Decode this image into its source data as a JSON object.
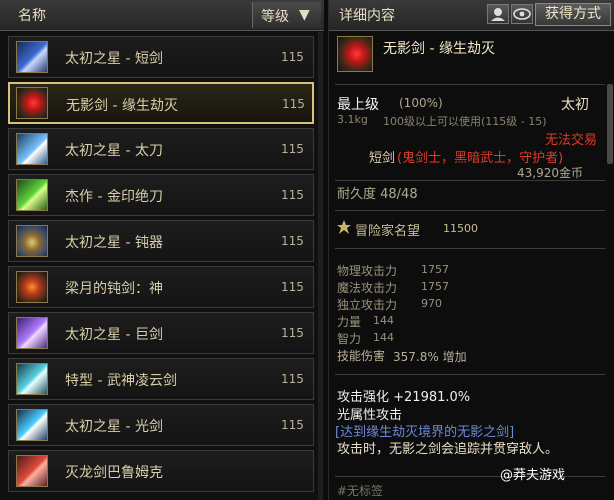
{
  "list": {
    "header_name": "名称",
    "header_level": "等级",
    "header_sort_arrow": "▼",
    "items": [
      {
        "name": "太初之星 - 短剑",
        "level": "115",
        "icon": "short-sword-icon"
      },
      {
        "name": "无影剑 - 缘生劫灭",
        "level": "115",
        "icon": "wuying-sword-icon"
      },
      {
        "name": "太初之星 - 太刀",
        "level": "115",
        "icon": "katana-icon"
      },
      {
        "name": "杰作 - 金印绝刀",
        "level": "115",
        "icon": "gold-blade-icon"
      },
      {
        "name": "太初之星 - 钝器",
        "level": "115",
        "icon": "blunt-weapon-icon"
      },
      {
        "name": "梁月的钝剑：神",
        "level": "115",
        "icon": "blunt-sword-icon"
      },
      {
        "name": "太初之星 - 巨剑",
        "level": "115",
        "icon": "greatsword-icon"
      },
      {
        "name": "特型 - 武神凌云剑",
        "level": "115",
        "icon": "lingyun-sword-icon"
      },
      {
        "name": "太初之星 - 光剑",
        "level": "115",
        "icon": "lightsaber-icon"
      },
      {
        "name": "灭龙剑巴鲁姆克",
        "level": "",
        "icon": "dragon-sword-icon"
      }
    ]
  },
  "detail": {
    "header_title": "详细内容",
    "acquire_button": "获得方式",
    "item_name": "无影剑 - 缘生劫灭",
    "grade": "最上级",
    "grade_pct": "(100%)",
    "rarity": "太初",
    "weight": "3.1kg",
    "usage": "100级以上可以使用(115级 - 15)",
    "untradeable": "无法交易",
    "type_prefix": "短剑",
    "classes": "(鬼剑士，黑暗武士，守护者)",
    "price": "43,920金币",
    "durability": "耐久度 48/48",
    "fame_label": "冒险家名望",
    "fame_value": "11500",
    "stats": [
      {
        "label": "物理攻击力",
        "value": "1757"
      },
      {
        "label": "魔法攻击力",
        "value": "1757"
      },
      {
        "label": "独立攻击力",
        "value": "970"
      },
      {
        "label": "力量",
        "value": "144"
      },
      {
        "label": "智力",
        "value": "144"
      },
      {
        "label": "技能伤害",
        "value": "357.8% 增加"
      }
    ],
    "attack_boost": "攻击强化 +21981.0%",
    "light_attack": "光属性攻击",
    "reach_realm": "[达到缘生劫灭境界的无影之剑]",
    "description": "攻击时，无影之剑会追踪并贯穿敌人。",
    "tag": "#无标签"
  },
  "watermark": "@莽夫游戏"
}
